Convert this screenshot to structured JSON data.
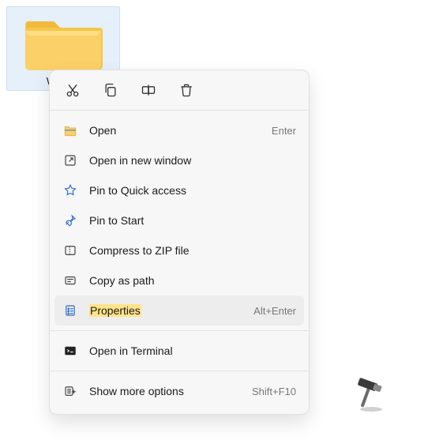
{
  "desktop": {
    "folder_label": "Wind…"
  },
  "toolbar": {
    "icons": [
      "cut-icon",
      "copy-icon",
      "rename-icon",
      "delete-icon"
    ]
  },
  "menu": {
    "open": {
      "label": "Open",
      "shortcut": "Enter"
    },
    "open_new_window": {
      "label": "Open in new window"
    },
    "pin_quick_access": {
      "label": "Pin to Quick access"
    },
    "pin_start": {
      "label": "Pin to Start"
    },
    "compress_zip": {
      "label": "Compress to ZIP file"
    },
    "copy_path": {
      "label": "Copy as path"
    },
    "properties": {
      "label": "Properties",
      "shortcut": "Alt+Enter"
    },
    "open_terminal": {
      "label": "Open in Terminal"
    },
    "show_more": {
      "label": "Show more options",
      "shortcut": "Shift+F10"
    }
  }
}
